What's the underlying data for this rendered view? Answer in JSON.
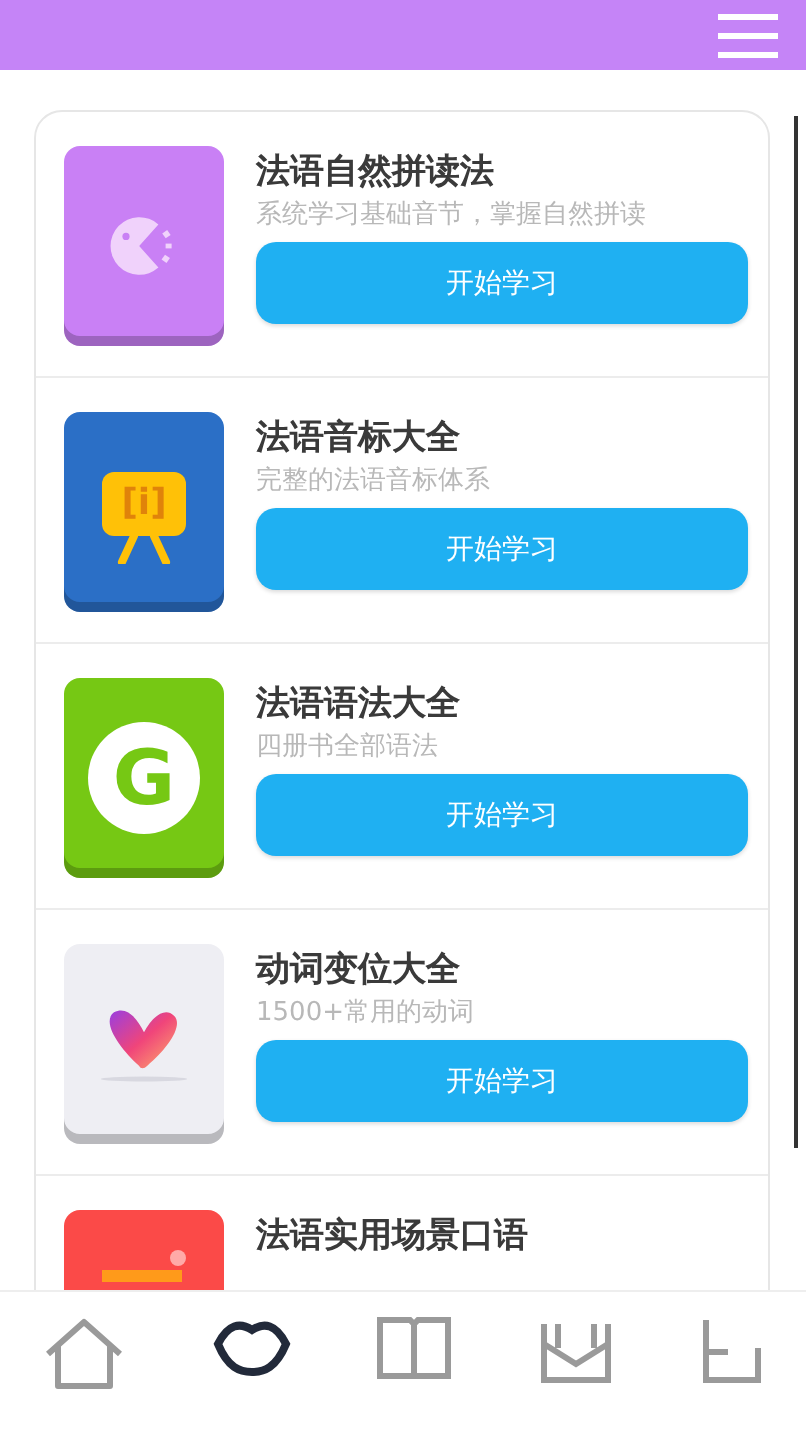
{
  "courses": [
    {
      "title": "法语自然拼读法",
      "subtitle": "系统学习基础音节，掌握自然拼读",
      "button": "开始学习",
      "color": "#c980f5",
      "kind": "pacman"
    },
    {
      "title": "法语音标大全",
      "subtitle": "完整的法语音标体系",
      "button": "开始学习",
      "color": "#2b6fc6",
      "kind": "sign",
      "icon_text": "[i]"
    },
    {
      "title": "法语语法大全",
      "subtitle": "四册书全部语法",
      "button": "开始学习",
      "color": "#76c814",
      "kind": "letter",
      "icon_text": "G"
    },
    {
      "title": "动词变位大全",
      "subtitle": "1500+常用的动词",
      "button": "开始学习",
      "color": "#eeeef3",
      "kind": "heart"
    },
    {
      "title": "法语实用场景口语",
      "color": "#fb4a48",
      "kind": "chat"
    }
  ],
  "tabs": [
    {
      "selected": false
    },
    {
      "selected": true
    },
    {
      "selected": false
    },
    {
      "selected": false
    },
    {
      "selected": false
    }
  ]
}
